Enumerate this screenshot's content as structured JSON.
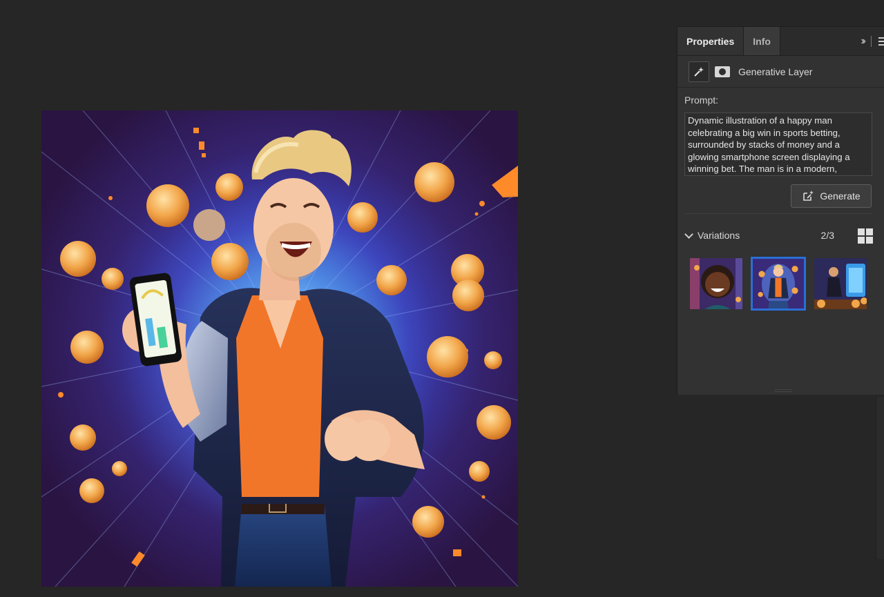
{
  "panel": {
    "tabs": [
      {
        "label": "Properties",
        "active": true
      },
      {
        "label": "Info",
        "active": false
      }
    ],
    "collapse_icon": "double-chevron-right-icon",
    "menu_icon": "hamburger-menu-icon"
  },
  "layer": {
    "label": "Generative Layer",
    "type_icon": "sparkle-icon",
    "mask_icon": "mask-icon"
  },
  "prompt": {
    "label": "Prompt:",
    "text": "Dynamic illustration of a happy man celebrating a big win in sports betting, surrounded by stacks of money and a glowing smartphone screen displaying a winning bet. The man is in a modern,"
  },
  "generate": {
    "label": "Generate",
    "icon": "generate-icon"
  },
  "variations": {
    "title": "Variations",
    "count": "2/3",
    "selected_index": 1,
    "view_icon": "grid-view-icon"
  },
  "colors": {
    "workspace_bg": "#262626",
    "panel_bg": "#323232",
    "selection_accent": "#2a6fd6",
    "canvas_purple": "#35236f",
    "shirt_orange": "#f2762a",
    "coin_gold": "#f2a64a"
  }
}
